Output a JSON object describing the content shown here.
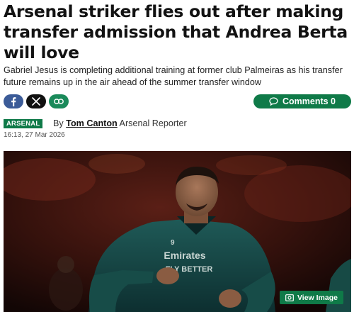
{
  "article": {
    "headline": "Arsenal striker flies out after making transfer admission that Andrea Berta will love",
    "standfirst": "Gabriel Jesus is completing additional training at former club Palmeiras as his transfer future remains up in the air ahead of the summer transfer window",
    "section": "ARSENAL",
    "byline_prefix": "By",
    "author": "Tom Canton",
    "author_role": "Arsenal Reporter",
    "timestamp": "16:13, 27 Mar 2026"
  },
  "share": {
    "facebook_icon": "facebook-icon",
    "x_icon": "x-icon",
    "link_icon": "link-icon"
  },
  "comments": {
    "label": "Comments 0"
  },
  "image": {
    "view_label": "View Image",
    "shirt_text": "Emirates\nFLY BETTER",
    "shirt_number": "9"
  },
  "colors": {
    "brand_green": "#0f7a48",
    "facebook_blue": "#3b5b98",
    "x_black": "#111111"
  }
}
